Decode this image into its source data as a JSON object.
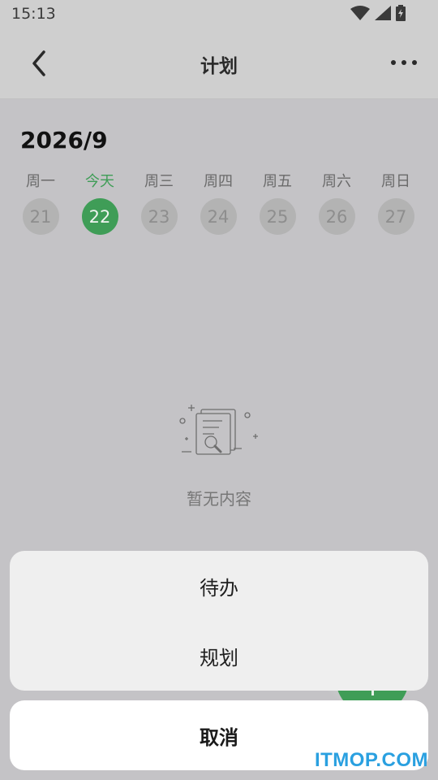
{
  "status_bar": {
    "time": "15:13"
  },
  "header": {
    "title": "计划"
  },
  "calendar": {
    "month_title": "2026/9",
    "days": [
      {
        "label": "周一",
        "date": "21",
        "today": false
      },
      {
        "label": "今天",
        "date": "22",
        "today": true
      },
      {
        "label": "周三",
        "date": "23",
        "today": false
      },
      {
        "label": "周四",
        "date": "24",
        "today": false
      },
      {
        "label": "周五",
        "date": "25",
        "today": false
      },
      {
        "label": "周六",
        "date": "26",
        "today": false
      },
      {
        "label": "周日",
        "date": "27",
        "today": false
      }
    ]
  },
  "empty_state": {
    "text": "暂无内容",
    "icon": "document-search-icon"
  },
  "action_sheet": {
    "options": [
      "待办",
      "规划"
    ],
    "cancel_label": "取消"
  },
  "watermark": "ITMOP.COM",
  "colors": {
    "accent": "#3f9d57",
    "watermark": "#2aa0e0"
  }
}
